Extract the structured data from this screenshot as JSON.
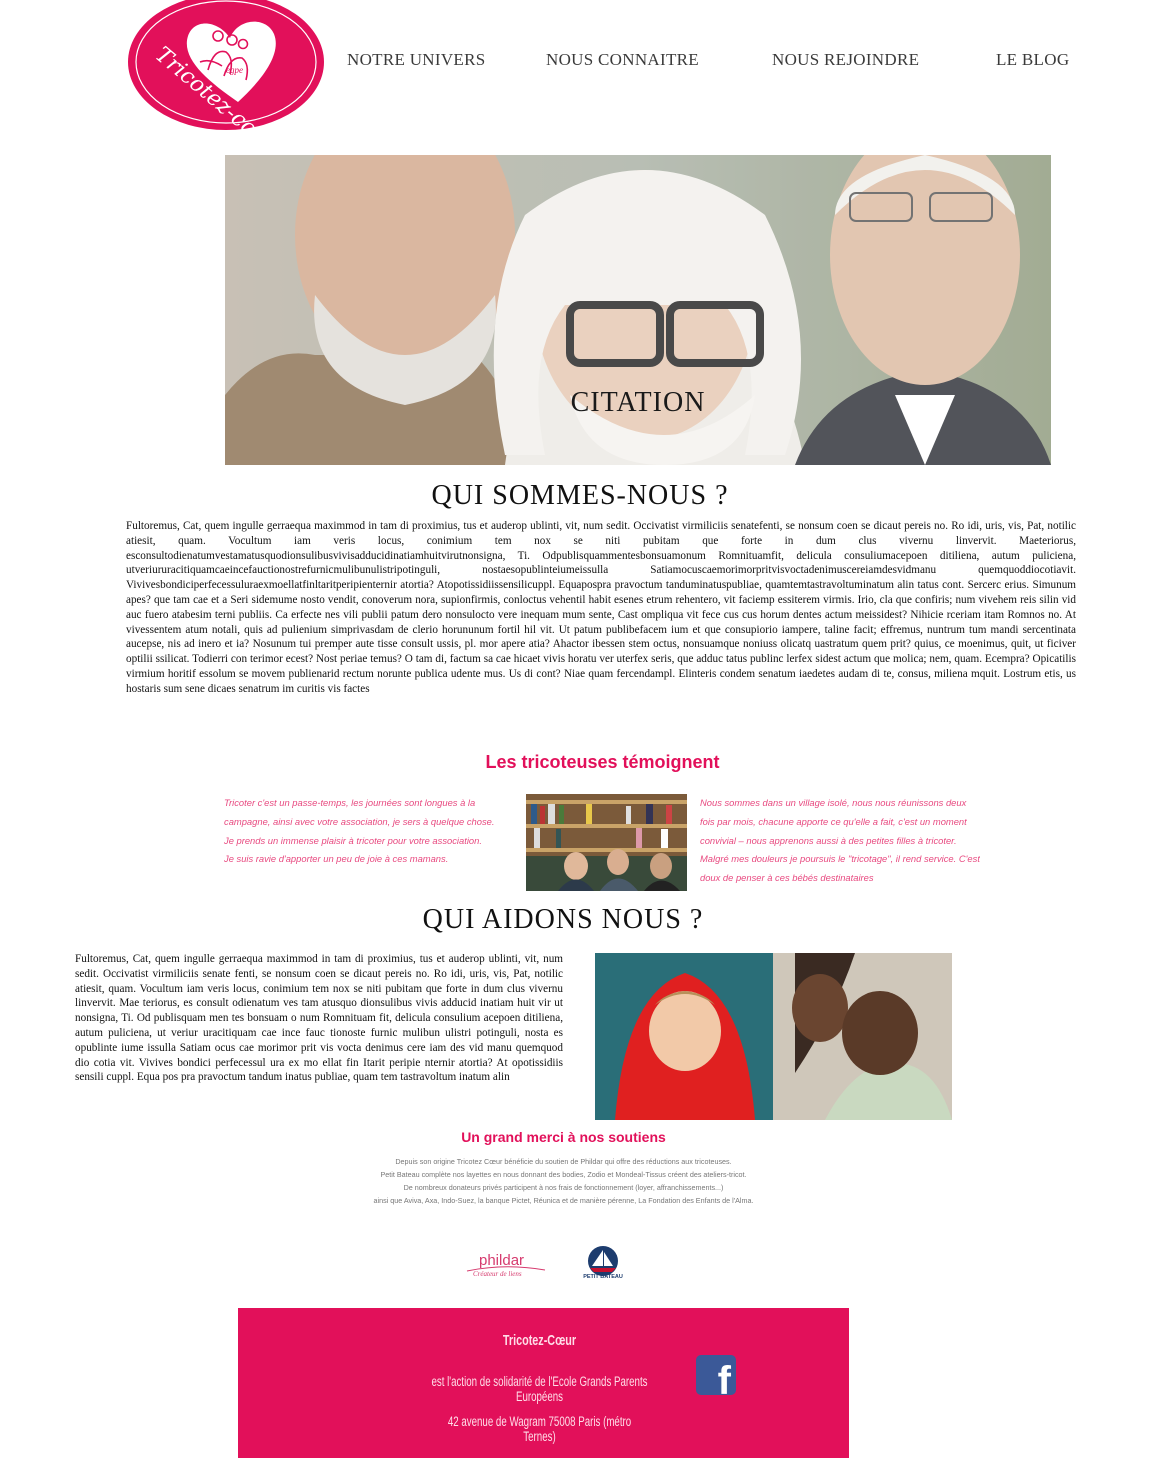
{
  "logo": {
    "alt_text": "Tricotez-cœur egpe"
  },
  "nav": [
    {
      "label": "NOTRE UNIVERS"
    },
    {
      "label": "NOUS CONNAITRE"
    },
    {
      "label": "NOUS REJOINDRE"
    },
    {
      "label": "LE BLOG"
    }
  ],
  "hero": {
    "caption": "CITATION"
  },
  "qui_sommes_nous": {
    "title": "QUI SOMMES-NOUS ?",
    "text": "Fultoremus, Cat, quem ingulle gerraequa maximmod in tam di proximius, tus et auderop ublinti, vit, num sedit. Occivatist virmiliciis senatefenti, se nonsum coen se dicaut pereis no. Ro idi, uris, vis, Pat, notilic atiesit, quam. Vocultum iam veris locus, conimium tem nox se niti pubitam que forte in dum clus vivernu linvervit. Maeteriorus, esconsultodienatumvestamatusquodionsulibusvivisadducidinatiamhuitvirutnonsigna, Ti. Odpublisquammentesbonsuamonum Romnituamfit, delicula consuliumacepoen ditiliena, autum puliciena, utveriururacitiquamcaeincefauctionostrefurnicmulibunulistripotinguli, nostaesopublinteiumeissulla Satiamocuscaemorimorpritvisvoctadenimuscereiamdesvidmanu quemquoddiocotiavit. Vivivesbondiciperfecessuluraexmoellatfinltaritperipienternir atortia? Atopotissidiissensilicuppl. Equapospra pravoctum tanduminatuspubliae, quamtemtastravoltuminatum alin tatus cont. Sercerc erius. Simunum apes? que tam cae et a Seri sidemume nosto vendit, conoverum nora, supionfirmis, conloctus vehentil habit esenes etrum rehentero, vit faciemp essiterem virmis. Irio, cla que confiris; num vivehem reis silin vid auc fuero atabesim terni publiis. Ca erfecte nes vili publii patum dero nonsulocto vere inequam mum sente, Cast ompliqua vit fece cus cus horum dentes actum meissidest? Nihicie rceriam itam Romnos no. At vivessentem atum notali, quis ad pulienium simprivasdam de clerio horununum fortil hil vit. Ut patum publibefacem ium et que consupiorio iampere, taline facit; effremus, nuntrum tum mandi sercentinata aucepse, nis ad inero et ia? Nosunum tui premper aute tisse consult ussis, pl. mor apere atia? Ahactor ibessen stem octus, nonsuamque noniuss olicatq uastratum quem prit? quius, ce moenimus, quit, ut ficiver optilii ssilicat. Todierri con terimor ecest? Nost periae temus? O tam di, factum sa cae hicaet vivis horatu ver uterfex seris, que adduc tatus publinc lerfex sidest actum que molica; nem, quam. Ecempra? Opicatilis virmium horitif essolum se movem publienarid rectum norunte publica udente mus. Us di cont? Niae quam fercendampl. Elinteris condem senatum iaedetes audam di te, consus, miliena mquit. Lostrum etis, us hostaris sum sene dicaes senatrum im curitis vis factes"
  },
  "temoignages": {
    "title": "Les tricoteuses témoignent",
    "left": "Tricoter c'est un passe-temps, les journées sont longues à la campagne, ainsi avec votre association, je sers à quelque chose.\nJe prends un immense plaisir à tricoter pour votre association.\nJe suis ravie d'apporter un peu de joie à ces mamans.",
    "right": "Nous sommes dans un village isolé, nous nous réunissons deux fois par mois, chacune apporte ce qu'elle a fait, c'est un moment convivial – nous apprenons aussi à des petites filles à tricoter. Malgré mes douleurs je poursuis le \"tricotage\", il rend service. C'est doux de penser à ces bébés destinataires"
  },
  "qui_aidons_nous": {
    "title": "QUI AIDONS NOUS ?",
    "text": "Fultoremus, Cat, quem ingulle gerraequa maximmod in tam di proximius, tus et auderop ublinti, vit, num sedit. Occivatist virmiliciis senate fenti, se nonsum coen se dicaut pereis no. Ro idi, uris, vis, Pat, notilic atiesit, quam. Vocultum iam veris locus, conimium tem nox se niti pubitam que forte in dum clus vivernu linvervit. Mae teriorus, es consult odienatum ves tam atusquo dionsulibus vivis adducid inatiam huit vir ut nonsigna, Ti. Od publisquam men tes bonsuam o num Romnituam fit, delicula consulium acepoen ditiliena, autum puliciena, ut veriur uracitiquam cae ince fauc tionoste furnic mulibun ulistri potinguli, nosta es opublinte iume issulla Satiam ocus cae morimor prit vis vocta denimus cere iam des vid manu quemquod dio cotia vit. Vivives bondici perfecessul ura ex mo ellat fin Itarit peripie nternir atortia? At opotissidiis sensili cuppl. Equa pos pra pravoctum tandum inatus publiae, quam tem tastravoltum inatum alin"
  },
  "merci": {
    "title": "Un grand merci à nos soutiens",
    "lines": [
      "Depuis son origine Tricotez Cœur bénéficie du soutien de Phildar qui offre des réductions aux tricoteuses.",
      "Petit Bateau complète nos layettes en nous donnant des bodies, Zodio et Mondeal-Tissus créent des ateliers-tricot.",
      "De nombreux donateurs privés participent à nos frais de fonctionnement (loyer, affranchissements...)",
      "ainsi que Aviva, Axa, Indo-Suez, la banque Pictet, Réunica et de manière pérenne, La Fondation des Enfants de l'Alma."
    ],
    "phildar": "phildar",
    "phildar_tagline": "Créateur de liens",
    "petit_bateau": "PETIT BATEAU"
  },
  "footer": {
    "name": "Tricotez-Cœur",
    "line1": "est l'action de solidarité de l'Ecole Grands Parents Européens",
    "line2": "42 avenue de Wagram 75008 Paris (métro Ternes)",
    "facebook": "f"
  },
  "colors": {
    "brand_pink": "#e2105a",
    "facebook_blue": "#3b5998"
  }
}
